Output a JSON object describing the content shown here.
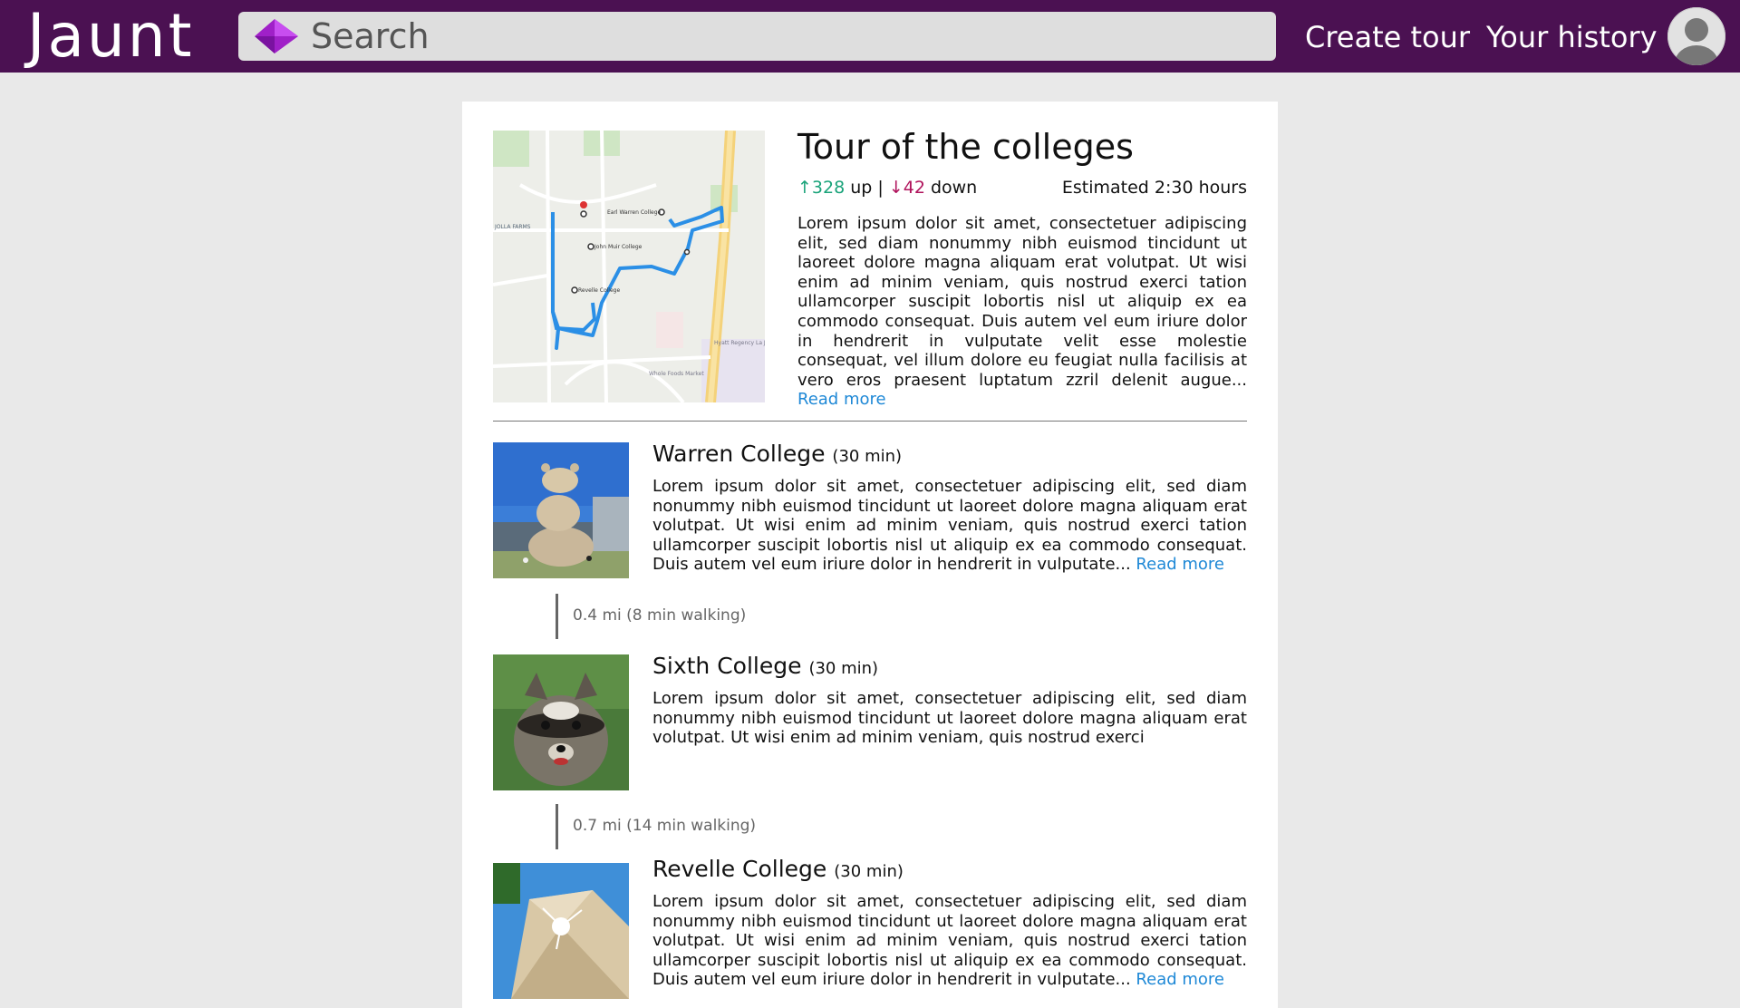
{
  "header": {
    "logo": "Jaunt",
    "search_placeholder": "Search",
    "nav": {
      "create_tour": "Create tour",
      "history": "Your history"
    }
  },
  "tour": {
    "title": "Tour of the colleges",
    "up_arrow": "↑",
    "up_count": "328",
    "up_label": " up | ",
    "down_arrow": "↓",
    "down_count": "42",
    "down_label": " down",
    "estimate": "Estimated 2:30 hours",
    "description": "Lorem ipsum dolor sit amet, consectetuer adipiscing elit, sed diam nonummy nibh euismod tincidunt ut laoreet dolore magna aliquam erat volutpat. Ut wisi enim ad minim veniam, quis nostrud exerci tation ullamcorper suscipit lobortis nisl ut aliquip ex ea commodo consequat. Duis autem vel eum iriure dolor in hendrerit in vulputate velit esse molestie consequat, vel illum dolore eu feugiat nulla facilisis at vero eros praesent luptatum zzril delenit augue...",
    "read_more": "Read more",
    "map_labels": [
      "Earl Warren College",
      "John Muir College",
      "Revelle College",
      "JOLLA FARMS",
      "Hyatt Regency La Jolla",
      "Whole Foods Market"
    ]
  },
  "stops": [
    {
      "name": "Warren College",
      "duration": "(30 min)",
      "description": "Lorem ipsum dolor sit amet, consectetuer adipiscing elit, sed diam nonummy nibh euismod tincidunt ut laoreet dolore magna aliquam erat volutpat. Ut wisi enim ad minim veniam, quis nostrud exerci tation ullamcorper suscipit lobortis nisl ut aliquip ex ea commodo consequat. Duis autem vel eum iriure dolor in hendrerit in vulputate...",
      "read_more": "Read more"
    },
    {
      "name": "Sixth College",
      "duration": "(30 min)",
      "description": "Lorem ipsum dolor sit amet, consectetuer adipiscing elit, sed diam nonummy nibh euismod tincidunt ut laoreet dolore magna aliquam erat volutpat. Ut wisi enim ad minim veniam, quis nostrud exerci"
    },
    {
      "name": "Revelle College",
      "duration": "(30 min)",
      "description": "Lorem ipsum dolor sit amet, consectetuer adipiscing elit, sed diam nonummy nibh euismod tincidunt ut laoreet dolore magna aliquam erat volutpat. Ut wisi enim ad minim veniam, quis nostrud exerci tation ullamcorper suscipit lobortis nisl ut aliquip ex ea commodo consequat. Duis autem vel eum iriure dolor in hendrerit in vulputate...",
      "read_more": "Read more"
    }
  ],
  "walks": [
    "0.4 mi (8 min walking)",
    "0.7 mi (14 min walking)"
  ],
  "colors": {
    "header": "#4b1152",
    "up": "#1aa37a",
    "down": "#b0135c",
    "link": "#1e88d6"
  }
}
